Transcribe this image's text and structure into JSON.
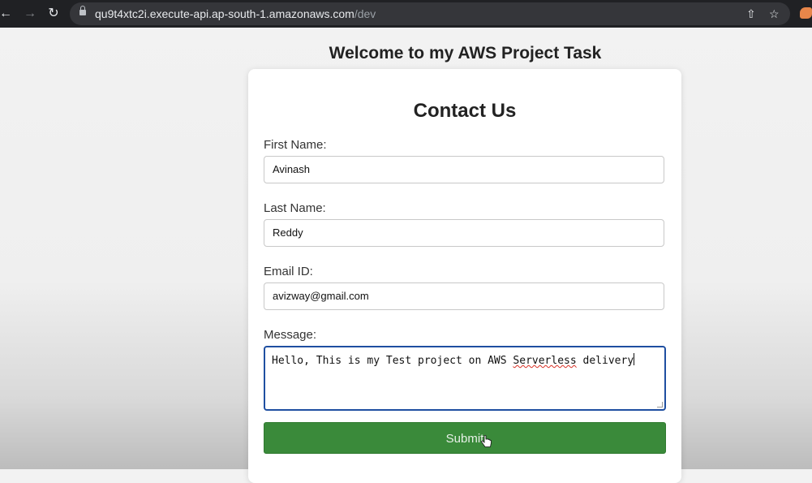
{
  "browser": {
    "url_host": "qu9t4xtc2i.execute-api.ap-south-1.amazonaws.com",
    "url_path": "/dev",
    "icons": [
      "back-arrow-icon",
      "forward-arrow-icon",
      "reload-icon",
      "lock-icon",
      "share-icon",
      "bookmark-star-icon",
      "extension-icon"
    ]
  },
  "page": {
    "heading": "Welcome to my AWS Project Task"
  },
  "form": {
    "title": "Contact Us",
    "first_name_label": "First Name:",
    "first_name_value": "Avinash",
    "last_name_label": "Last Name:",
    "last_name_value": "Reddy",
    "email_label": "Email ID:",
    "email_value": "avizway@gmail.com",
    "message_label": "Message:",
    "message_before": "Hello, This is my Test project on AWS ",
    "message_misspelled": "Serverless",
    "message_after": " delivery",
    "submit_label": "Submit"
  },
  "colors": {
    "submit_bg": "#3a8a3a",
    "focus_border": "#1f4fa1",
    "chrome_bg": "#202124"
  }
}
